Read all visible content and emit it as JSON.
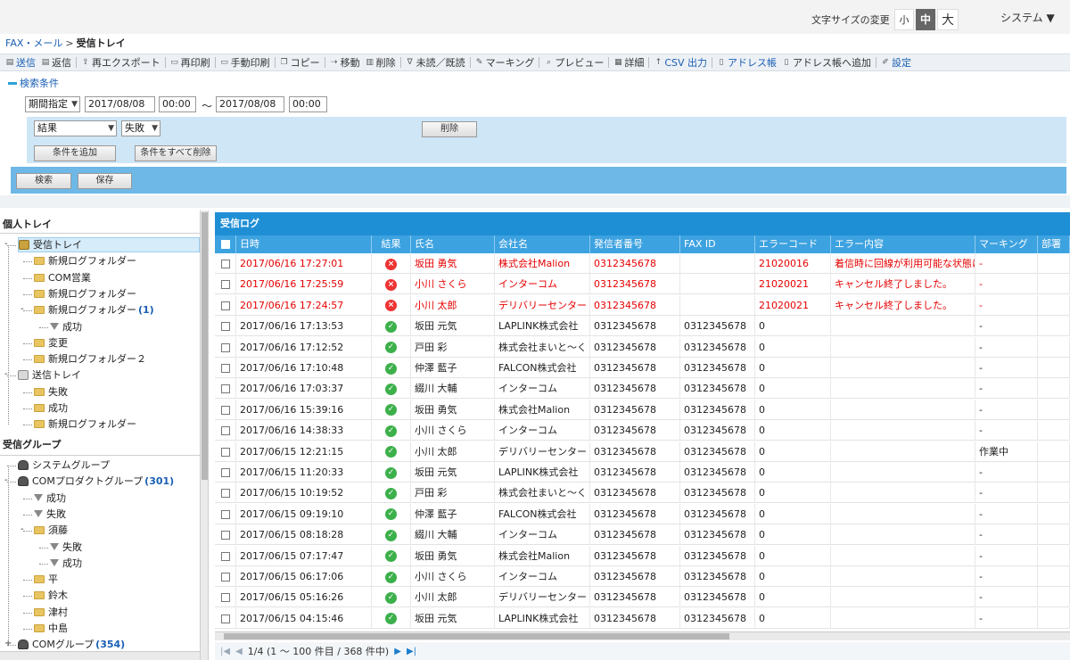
{
  "header": {
    "font_size_label": "文字サイズの変更",
    "font_sizes": [
      "小",
      "中",
      "大"
    ],
    "selected_font_size": "中",
    "system_menu": "システム ▼"
  },
  "breadcrumb": {
    "parent": "FAX・メール",
    "separator": ">",
    "current": "受信トレイ"
  },
  "toolbar": [
    {
      "label": "送信",
      "icon": "send-icon",
      "blue": true
    },
    {
      "label": "返信",
      "icon": "reply-icon",
      "blue": false
    },
    {
      "label": "再エクスポート",
      "icon": "export-icon",
      "blue": false
    },
    {
      "label": "再印刷",
      "icon": "print-icon",
      "blue": false
    },
    {
      "label": "手動印刷",
      "icon": "print-icon",
      "blue": false
    },
    {
      "label": "コピー",
      "icon": "copy-icon",
      "blue": false
    },
    {
      "label": "移動",
      "icon": "move-icon",
      "blue": false
    },
    {
      "label": "削除",
      "icon": "trash-icon",
      "blue": false
    },
    {
      "label": "未読／既読",
      "icon": "filter-icon",
      "blue": false
    },
    {
      "label": "マーキング",
      "icon": "marker-icon",
      "blue": false
    },
    {
      "label": "プレビュー",
      "icon": "preview-icon",
      "blue": false
    },
    {
      "label": "詳細",
      "icon": "detail-icon",
      "blue": false
    },
    {
      "label": "CSV 出力",
      "icon": "upload-icon",
      "blue": true
    },
    {
      "label": "アドレス帳",
      "icon": "addressbook-icon",
      "blue": true
    },
    {
      "label": "アドレス帳へ追加",
      "icon": "addressbook-add-icon",
      "blue": false
    },
    {
      "label": "設定",
      "icon": "wrench-icon",
      "blue": true
    }
  ],
  "search": {
    "title": "検索条件",
    "period_select": "期間指定",
    "date_from": "2017/08/08",
    "time_from": "00:00",
    "tilde": "～",
    "date_to": "2017/08/08",
    "time_to": "00:00",
    "condition_field": "結果",
    "condition_value": "失敗",
    "delete_label": "削除",
    "add_condition_label": "条件を追加",
    "delete_all_label": "条件をすべて削除",
    "search_label": "検索",
    "save_label": "保存"
  },
  "tree": {
    "personal_header": "個人トレイ",
    "group_header": "受信グループ",
    "personal": [
      {
        "label": "受信トレイ",
        "icon": "inbox-tray-icon",
        "level": 0,
        "expander": "-",
        "selected": true
      },
      {
        "label": "新規ログフォルダー",
        "icon": "folder-icon",
        "level": 1
      },
      {
        "label": "COM営業",
        "icon": "folder-icon",
        "level": 1
      },
      {
        "label": "新規ログフォルダー",
        "icon": "folder-icon",
        "level": 1
      },
      {
        "label": "新規ログフォルダー",
        "count": "(1)",
        "icon": "folder-icon",
        "level": 1,
        "expander": "-"
      },
      {
        "label": "成功",
        "icon": "filter-icon",
        "level": 2
      },
      {
        "label": "変更",
        "icon": "folder-icon",
        "level": 1
      },
      {
        "label": "新規ログフォルダー２",
        "icon": "folder-icon",
        "level": 1
      },
      {
        "label": "送信トレイ",
        "icon": "outbox-tray-icon",
        "level": 0,
        "expander": "-"
      },
      {
        "label": "失敗",
        "icon": "folder-icon",
        "level": 1
      },
      {
        "label": "成功",
        "icon": "folder-icon",
        "level": 1
      },
      {
        "label": "新規ログフォルダー",
        "icon": "folder-icon",
        "level": 1
      }
    ],
    "groups": [
      {
        "label": "システムグループ",
        "icon": "group-icon",
        "level": 0
      },
      {
        "label": "COMプロダクトグループ",
        "count": "(301)",
        "icon": "group-icon",
        "level": 0,
        "expander": "-"
      },
      {
        "label": "成功",
        "icon": "filter-icon",
        "level": 1
      },
      {
        "label": "失敗",
        "icon": "filter-icon",
        "level": 1
      },
      {
        "label": "須藤",
        "icon": "folder-icon",
        "level": 1,
        "expander": "-"
      },
      {
        "label": "失敗",
        "icon": "filter-icon",
        "level": 2
      },
      {
        "label": "成功",
        "icon": "filter-icon",
        "level": 2
      },
      {
        "label": "平",
        "icon": "folder-icon",
        "level": 1
      },
      {
        "label": "鈴木",
        "icon": "folder-icon",
        "level": 1
      },
      {
        "label": "津村",
        "icon": "folder-icon",
        "level": 1
      },
      {
        "label": "中島",
        "icon": "folder-icon",
        "level": 1
      },
      {
        "label": "COMグループ",
        "count": "(354)",
        "icon": "group-icon",
        "level": 0,
        "expander": "+"
      }
    ]
  },
  "log": {
    "title": "受信ログ",
    "columns": [
      "日時",
      "結果",
      "氏名",
      "会社名",
      "発信者番号",
      "FAX ID",
      "エラーコード",
      "エラー内容",
      "マーキング",
      "部署"
    ],
    "rows": [
      {
        "date": "2017/06/16 17:27:01",
        "result": "error",
        "name": "坂田 勇気",
        "company": "株式会社Malion",
        "caller": "0312345678",
        "fax_id": "",
        "error_code": "21020016",
        "error_text": "着信時に回線が利用可能な状態に",
        "marking": "-"
      },
      {
        "date": "2017/06/16 17:25:59",
        "result": "error",
        "name": "小川 さくら",
        "company": "インターコム",
        "caller": "0312345678",
        "fax_id": "",
        "error_code": "21020021",
        "error_text": "キャンセル終了しました。",
        "marking": "-"
      },
      {
        "date": "2017/06/16 17:24:57",
        "result": "error",
        "name": "小川 太郎",
        "company": "デリバリーセンター",
        "caller": "0312345678",
        "fax_id": "",
        "error_code": "21020021",
        "error_text": "キャンセル終了しました。",
        "marking": "-"
      },
      {
        "date": "2017/06/16 17:13:53",
        "result": "success",
        "name": "坂田 元気",
        "company": "LAPLINK株式会社",
        "caller": "0312345678",
        "fax_id": "0312345678",
        "error_code": "0",
        "error_text": "",
        "marking": "-"
      },
      {
        "date": "2017/06/16 17:12:52",
        "result": "success",
        "name": "戸田 彩",
        "company": "株式会社まいと～く",
        "caller": "0312345678",
        "fax_id": "0312345678",
        "error_code": "0",
        "error_text": "",
        "marking": "-"
      },
      {
        "date": "2017/06/16 17:10:48",
        "result": "success",
        "name": "仲澤 藍子",
        "company": "FALCON株式会社",
        "caller": "0312345678",
        "fax_id": "0312345678",
        "error_code": "0",
        "error_text": "",
        "marking": "-"
      },
      {
        "date": "2017/06/16 17:03:37",
        "result": "success",
        "name": "綴川 大輔",
        "company": "インターコム",
        "caller": "0312345678",
        "fax_id": "0312345678",
        "error_code": "0",
        "error_text": "",
        "marking": "-"
      },
      {
        "date": "2017/06/16 15:39:16",
        "result": "success",
        "name": "坂田 勇気",
        "company": "株式会社Malion",
        "caller": "0312345678",
        "fax_id": "0312345678",
        "error_code": "0",
        "error_text": "",
        "marking": "-"
      },
      {
        "date": "2017/06/16 14:38:33",
        "result": "success",
        "name": "小川 さくら",
        "company": "インターコム",
        "caller": "0312345678",
        "fax_id": "0312345678",
        "error_code": "0",
        "error_text": "",
        "marking": "-"
      },
      {
        "date": "2017/06/15 12:21:15",
        "result": "success",
        "name": "小川 太郎",
        "company": "デリバリーセンター",
        "caller": "0312345678",
        "fax_id": "0312345678",
        "error_code": "0",
        "error_text": "",
        "marking": "作業中"
      },
      {
        "date": "2017/06/15 11:20:33",
        "result": "success",
        "name": "坂田 元気",
        "company": "LAPLINK株式会社",
        "caller": "0312345678",
        "fax_id": "0312345678",
        "error_code": "0",
        "error_text": "",
        "marking": "-"
      },
      {
        "date": "2017/06/15 10:19:52",
        "result": "success",
        "name": "戸田 彩",
        "company": "株式会社まいと～く",
        "caller": "0312345678",
        "fax_id": "0312345678",
        "error_code": "0",
        "error_text": "",
        "marking": "-"
      },
      {
        "date": "2017/06/15 09:19:10",
        "result": "success",
        "name": "仲澤 藍子",
        "company": "FALCON株式会社",
        "caller": "0312345678",
        "fax_id": "0312345678",
        "error_code": "0",
        "error_text": "",
        "marking": "-"
      },
      {
        "date": "2017/06/15 08:18:28",
        "result": "success",
        "name": "綴川 大輔",
        "company": "インターコム",
        "caller": "0312345678",
        "fax_id": "0312345678",
        "error_code": "0",
        "error_text": "",
        "marking": "-"
      },
      {
        "date": "2017/06/15 07:17:47",
        "result": "success",
        "name": "坂田 勇気",
        "company": "株式会社Malion",
        "caller": "0312345678",
        "fax_id": "0312345678",
        "error_code": "0",
        "error_text": "",
        "marking": "-"
      },
      {
        "date": "2017/06/15 06:17:06",
        "result": "success",
        "name": "小川 さくら",
        "company": "インターコム",
        "caller": "0312345678",
        "fax_id": "0312345678",
        "error_code": "0",
        "error_text": "",
        "marking": "-"
      },
      {
        "date": "2017/06/15 05:16:26",
        "result": "success",
        "name": "小川 太郎",
        "company": "デリバリーセンター",
        "caller": "0312345678",
        "fax_id": "0312345678",
        "error_code": "0",
        "error_text": "",
        "marking": "-"
      },
      {
        "date": "2017/06/15 04:15:46",
        "result": "success",
        "name": "坂田 元気",
        "company": "LAPLINK株式会社",
        "caller": "0312345678",
        "fax_id": "0312345678",
        "error_code": "0",
        "error_text": "",
        "marking": "-"
      }
    ]
  },
  "pager": {
    "text": "1/4 (1 ～ 100 件目 / 368 件中)"
  },
  "colors": {
    "accent": "#1f8fd5",
    "header_row": "#3da2e0",
    "error_text": "#e60000",
    "success_icon": "#3cb04a",
    "error_icon": "#e33333",
    "condition_panel": "#cfe6f6",
    "action_panel": "#6db8e6"
  }
}
